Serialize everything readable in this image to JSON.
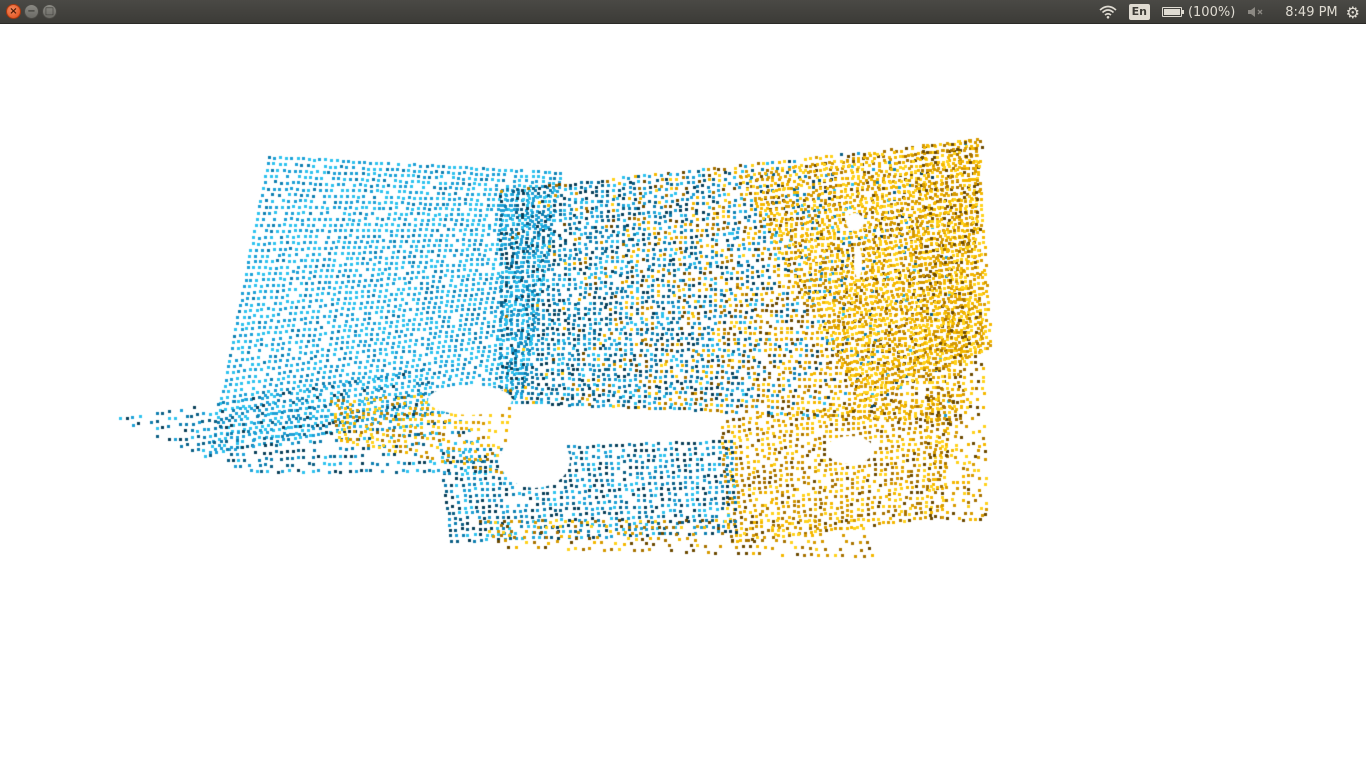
{
  "window": {
    "buttons": [
      {
        "name": "close-button",
        "glyph": "×"
      },
      {
        "name": "minimize-button",
        "glyph": "−"
      },
      {
        "name": "maximize-button",
        "glyph": "□"
      }
    ]
  },
  "panel": {
    "wifi_icon": "wifi-icon",
    "language": "En",
    "battery": {
      "icon": "battery-icon",
      "label": "(100%)",
      "level": 1.0
    },
    "volume_icon": "volume-muted-icon",
    "clock": "8:49 PM",
    "settings_icon": "gear-icon"
  },
  "viewer": {
    "background": "#ffffff",
    "point_colors": {
      "cyan": [
        "#2ec3ef",
        "#1ea0d6",
        "#0f7fb0",
        "#0b5f85",
        "#0a3f58"
      ],
      "gold": [
        "#ffd21c",
        "#f5b800",
        "#d69a00",
        "#a87300",
        "#6b4a00"
      ]
    }
  }
}
